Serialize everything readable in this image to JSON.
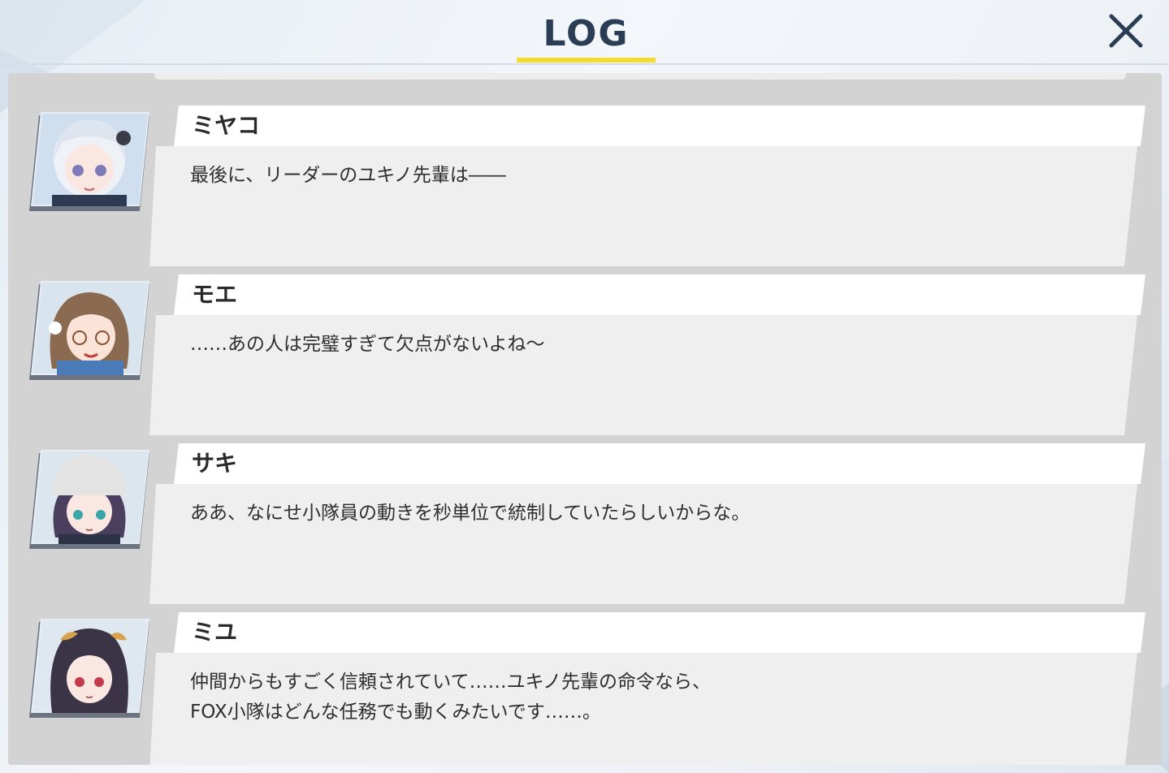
{
  "header": {
    "title": "LOG",
    "close_label": "close"
  },
  "colors": {
    "accent_underline": "#f4dc2e",
    "title_text": "#2b3d55",
    "panel_bg": "#d3d3d3",
    "bubble_bg": "#efefef",
    "name_bg": "#ffffff"
  },
  "log": {
    "entries": [
      {
        "speaker": "ミヤコ",
        "message": "最後に、リーダーのユキノ先輩は――",
        "avatar_icon": "character-portrait-miyako"
      },
      {
        "speaker": "モエ",
        "message": "……あの人は完璧すぎて欠点がないよね～",
        "avatar_icon": "character-portrait-moe"
      },
      {
        "speaker": "サキ",
        "message": "ああ、なにせ小隊員の動きを秒単位で統制していたらしいからな。",
        "avatar_icon": "character-portrait-saki"
      },
      {
        "speaker": "ミユ",
        "message": "仲間からもすごく信頼されていて……ユキノ先輩の命令なら、\nFOX小隊はどんな任務でも動くみたいです……。",
        "avatar_icon": "character-portrait-miyu"
      }
    ]
  }
}
